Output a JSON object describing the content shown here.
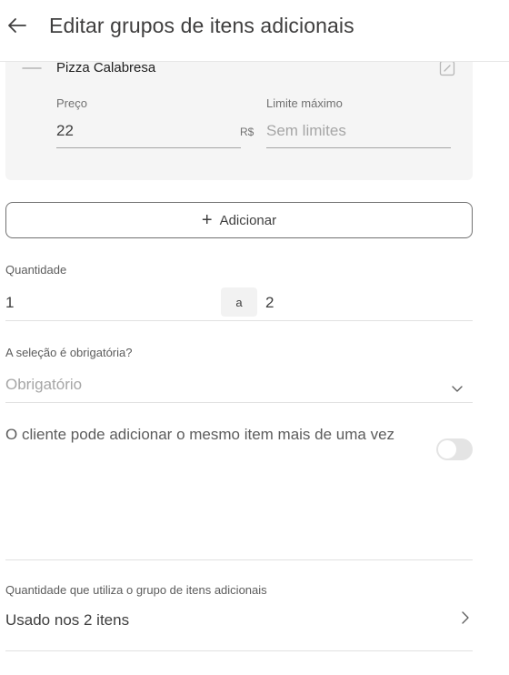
{
  "header": {
    "title": "Editar grupos de itens adicionais",
    "back_icon": "arrow-left-icon"
  },
  "item": {
    "name": "Pizza Calabresa",
    "price_label": "Preço",
    "price_value": "22",
    "currency": "R$",
    "limit_label": "Limite máximo",
    "limit_placeholder": "Sem limites",
    "drag_icon": "drag-handle-icon",
    "edit_icon": "edit-icon"
  },
  "add_button": {
    "label": "Adicionar",
    "icon": "plus-icon"
  },
  "quantity": {
    "label": "Quantidade",
    "min": "1",
    "separator": "a",
    "max": "2"
  },
  "required": {
    "label": "A seleção é obrigatória?",
    "value": "Obrigatório",
    "icon": "chevron-down-icon"
  },
  "repeat": {
    "text": "O cliente pode adicionar o mesmo item mais de uma vez",
    "enabled": false
  },
  "usage": {
    "label": "Quantidade que utiliza o grupo de itens adicionais",
    "value": "Usado nos 2 itens",
    "icon": "chevron-right-icon"
  },
  "colors": {
    "text": "#3e3e3e",
    "muted": "#a6a6a6",
    "card_bg": "#f5f5f5",
    "divider": "#e1e1e1"
  }
}
